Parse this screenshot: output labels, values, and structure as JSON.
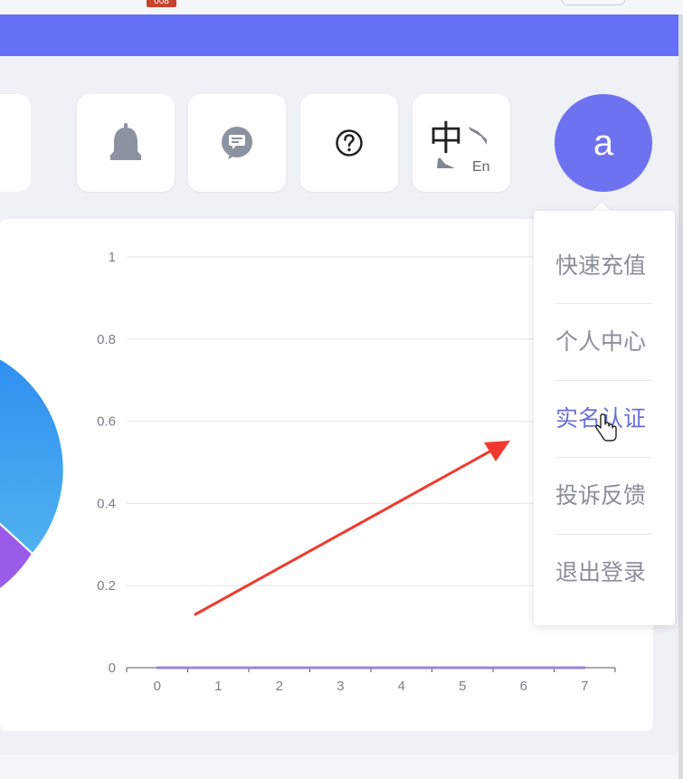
{
  "topbar": {
    "badge": "008"
  },
  "toolbar": {
    "buttons": [
      {
        "icon": "bell-icon"
      },
      {
        "icon": "message-icon"
      },
      {
        "icon": "help-icon"
      }
    ],
    "language": {
      "zh": "中",
      "en": "En"
    },
    "avatar_letter": "a"
  },
  "dropdown": {
    "items": [
      {
        "label": "快速充值"
      },
      {
        "label": "个人中心"
      },
      {
        "label": "实名认证"
      },
      {
        "label": "投诉反馈"
      },
      {
        "label": "退出登录"
      }
    ],
    "active_index": 2
  },
  "chart_data": {
    "type": "line",
    "x": [
      0,
      1,
      2,
      3,
      4,
      5,
      6,
      7
    ],
    "series": [
      {
        "values": [
          0,
          0,
          0,
          0,
          0,
          0,
          0,
          0
        ],
        "color": "#9b86d9"
      }
    ],
    "ylim": [
      0,
      1
    ],
    "y_ticks": [
      "0",
      "0.2",
      "0.4",
      "0.6",
      "0.8",
      "1"
    ],
    "x_ticks": [
      "0",
      "1",
      "2",
      "3",
      "4",
      "5",
      "6",
      "7"
    ],
    "grid": true
  },
  "colors": {
    "banner": "#6670f6",
    "avatar": "#6f72f0",
    "menu_active": "#6a6fd6",
    "arrow": "#f03a2f"
  }
}
